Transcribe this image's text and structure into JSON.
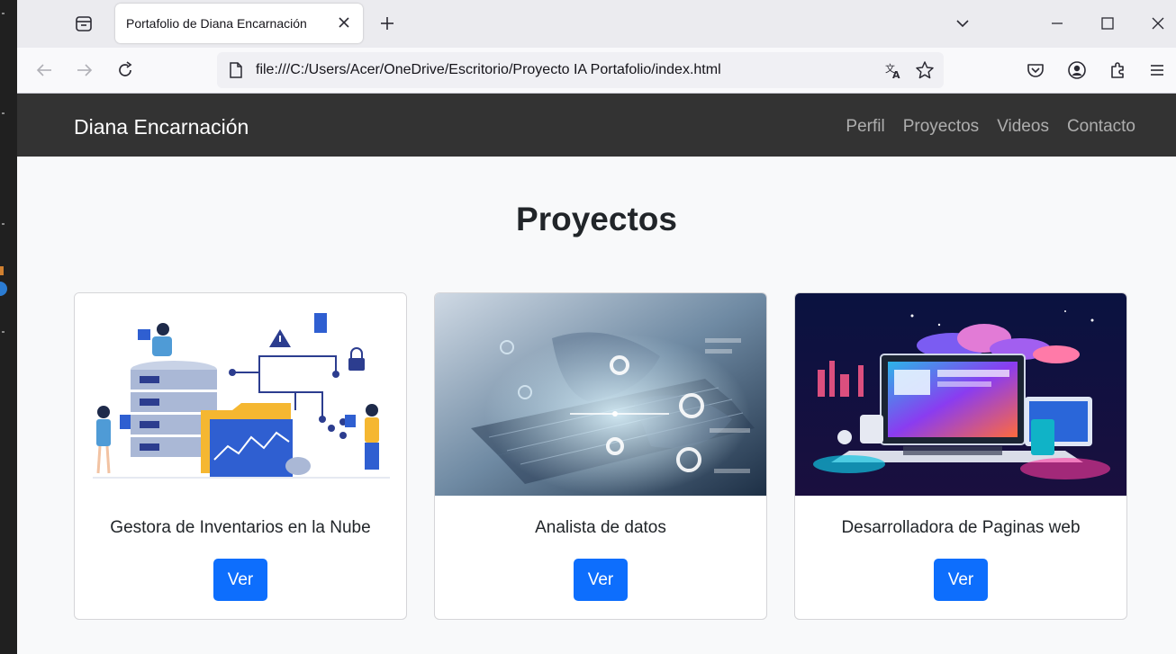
{
  "browser": {
    "tab_title": "Portafolio de Diana Encarnación",
    "url": "file:///C:/Users/Acer/OneDrive/Escritorio/Proyecto IA Portafolio/index.html"
  },
  "site": {
    "brand": "Diana Encarnación",
    "nav": [
      "Perfil",
      "Proyectos",
      "Videos",
      "Contacto"
    ],
    "section_title": "Proyectos",
    "cards": [
      {
        "title": "Gestora de Inventarios en la Nube",
        "button": "Ver"
      },
      {
        "title": "Analista de datos",
        "button": "Ver"
      },
      {
        "title": "Desarrolladora de Paginas web",
        "button": "Ver"
      }
    ]
  },
  "colors": {
    "navbar_bg": "#333333",
    "primary_button": "#0d6efd",
    "page_bg": "#f8f9fa"
  },
  "icons": [
    "tab-list-icon",
    "close-icon",
    "plus-icon",
    "chevron-down-icon",
    "minimize-icon",
    "maximize-icon",
    "window-close-icon",
    "back-arrow-icon",
    "forward-arrow-icon",
    "reload-icon",
    "page-icon",
    "translate-icon",
    "star-icon",
    "pocket-icon",
    "account-icon",
    "extensions-icon",
    "menu-icon"
  ]
}
